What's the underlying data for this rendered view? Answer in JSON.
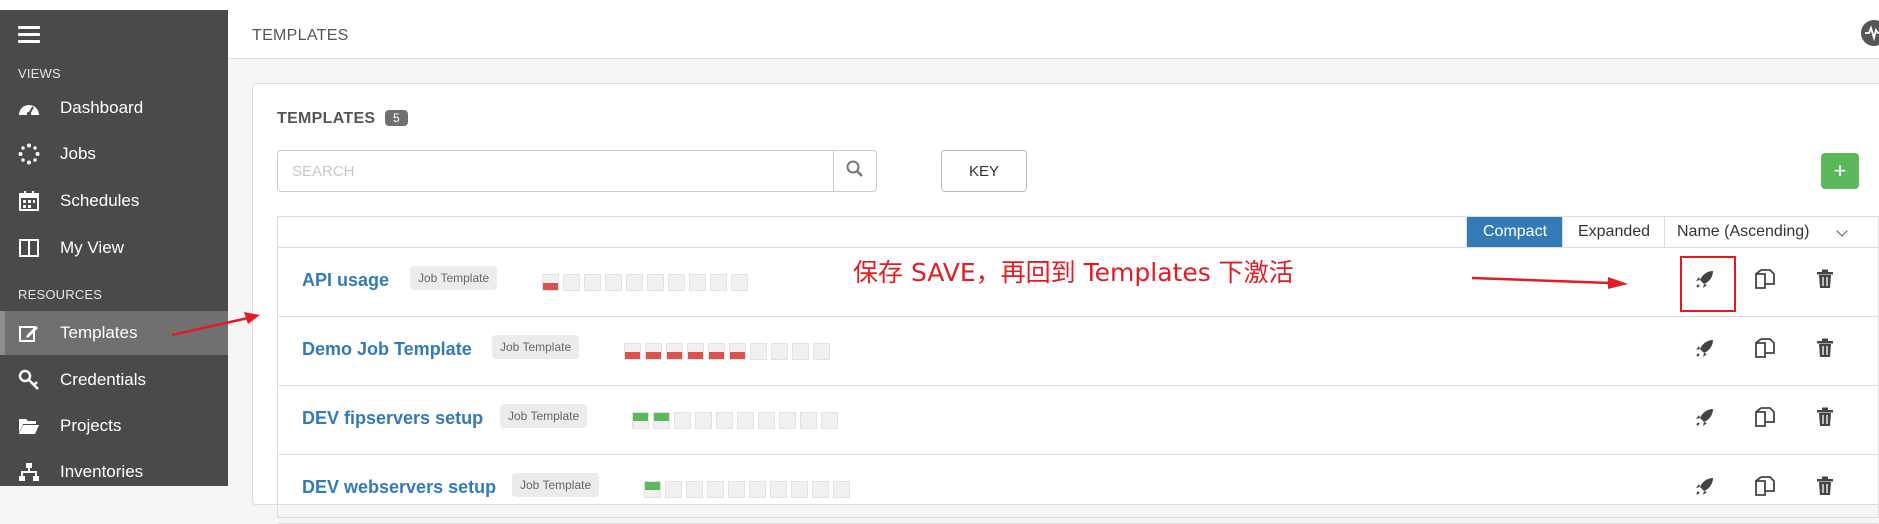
{
  "header": {
    "title": "TEMPLATES"
  },
  "sidebar": {
    "sections": {
      "views": "VIEWS",
      "resources": "RESOURCES"
    },
    "items": [
      {
        "label": "Dashboard",
        "icon": "dashboard-icon"
      },
      {
        "label": "Jobs",
        "icon": "spinner-icon"
      },
      {
        "label": "Schedules",
        "icon": "calendar-icon"
      },
      {
        "label": "My View",
        "icon": "columns-icon"
      },
      {
        "label": "Templates",
        "icon": "edit-icon",
        "active": true
      },
      {
        "label": "Credentials",
        "icon": "key-icon"
      },
      {
        "label": "Projects",
        "icon": "folder-open-icon"
      },
      {
        "label": "Inventories",
        "icon": "sitemap-icon"
      }
    ]
  },
  "panel": {
    "title": "TEMPLATES",
    "count": "5",
    "search_placeholder": "SEARCH",
    "key_label": "KEY",
    "add_label": "+",
    "view": {
      "compact": "Compact",
      "expanded": "Expanded",
      "sort": "Name (Ascending)",
      "selected": "Compact"
    }
  },
  "templates": [
    {
      "name": "API usage",
      "type": "Job Template",
      "jobs": [
        "fail",
        "none",
        "none",
        "none",
        "none",
        "none",
        "none",
        "none",
        "none",
        "none"
      ]
    },
    {
      "name": "Demo Job Template",
      "type": "Job Template",
      "jobs": [
        "fail",
        "fail",
        "fail",
        "fail",
        "fail",
        "fail",
        "none",
        "none",
        "none",
        "none"
      ]
    },
    {
      "name": "DEV fipservers setup",
      "type": "Job Template",
      "jobs": [
        "ok",
        "ok",
        "none",
        "none",
        "none",
        "none",
        "none",
        "none",
        "none",
        "none"
      ]
    },
    {
      "name": "DEV webservers setup",
      "type": "Job Template",
      "jobs": [
        "ok",
        "none",
        "none",
        "none",
        "none",
        "none",
        "none",
        "none",
        "none",
        "none"
      ]
    }
  ],
  "annotation": {
    "text": "保存 SAVE，再回到 Templates 下激活",
    "color": "#e31b23"
  },
  "colors": {
    "sidebar": "#4a4a4a",
    "accent": "#337ab7",
    "success": "#5cb85c",
    "failure": "#d9534f"
  }
}
